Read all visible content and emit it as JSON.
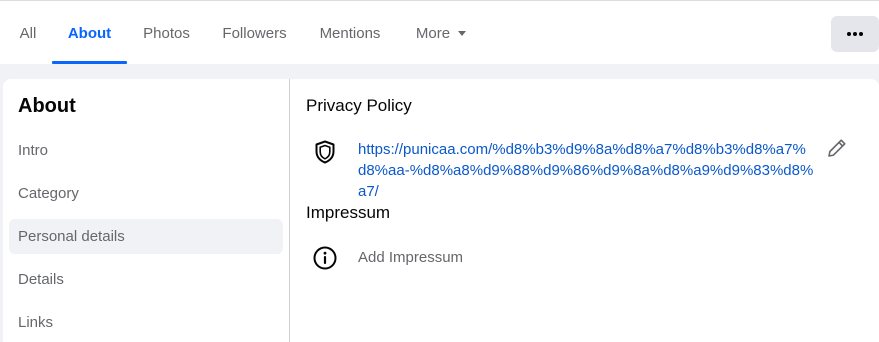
{
  "tabs": [
    {
      "label": "All"
    },
    {
      "label": "About"
    },
    {
      "label": "Photos"
    },
    {
      "label": "Followers"
    },
    {
      "label": "Mentions"
    },
    {
      "label": "More"
    }
  ],
  "sidebar": {
    "title": "About",
    "items": [
      {
        "label": "Intro"
      },
      {
        "label": "Category"
      },
      {
        "label": "Personal details"
      },
      {
        "label": "Details"
      },
      {
        "label": "Links"
      }
    ]
  },
  "privacy": {
    "title": "Privacy Policy",
    "url_line1": "https://punicaa.com/%d8%b3%d9%8a%d8%a7%d8%b3%d8%a7%",
    "url_line2": "d8%aa-%d8%a8%d9%88%d9%86%d9%8a%d8%a9%d9%83%d8%a7/"
  },
  "impressum": {
    "title": "Impressum",
    "add_label": "Add Impressum"
  },
  "colors": {
    "accent": "#0866ff",
    "link": "#0a58ca",
    "muted_text": "#65676b",
    "page_bg": "#f0f2f5"
  },
  "icons": {
    "more_menu": "ellipsis-icon",
    "privacy": "shield-icon",
    "edit": "pencil-icon",
    "impressum": "info-icon",
    "more_caret": "caret-down-icon"
  }
}
